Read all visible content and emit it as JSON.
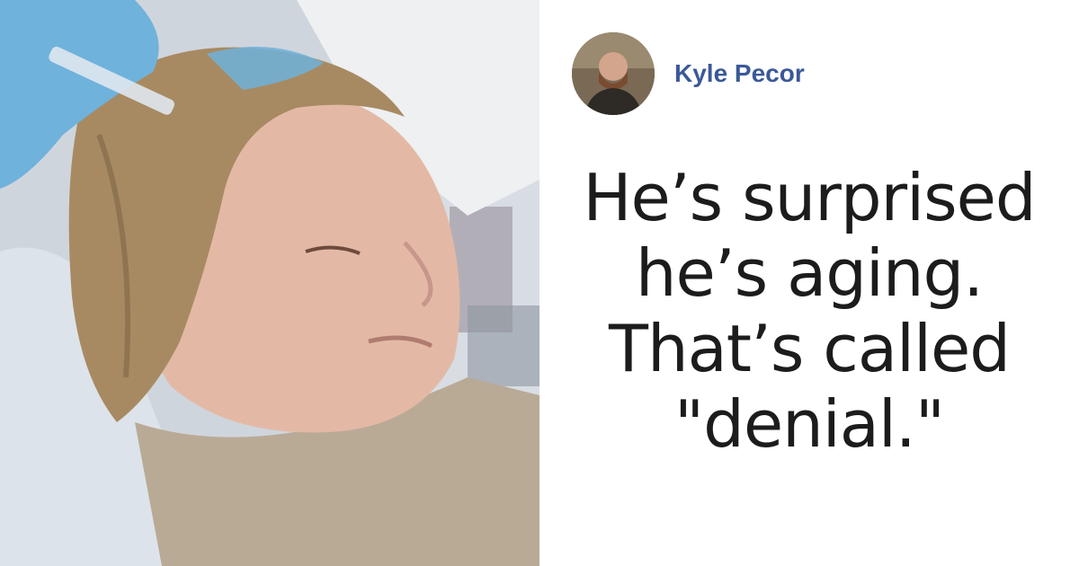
{
  "post": {
    "author_name": "Kyle Pecor",
    "quote_lines": [
      "He’s surprised",
      "he’s aging.",
      "That’s called",
      "\"denial.\""
    ]
  },
  "colors": {
    "author_name": "#3b5998",
    "quote_text": "#1c1c1c",
    "background": "#ffffff"
  }
}
